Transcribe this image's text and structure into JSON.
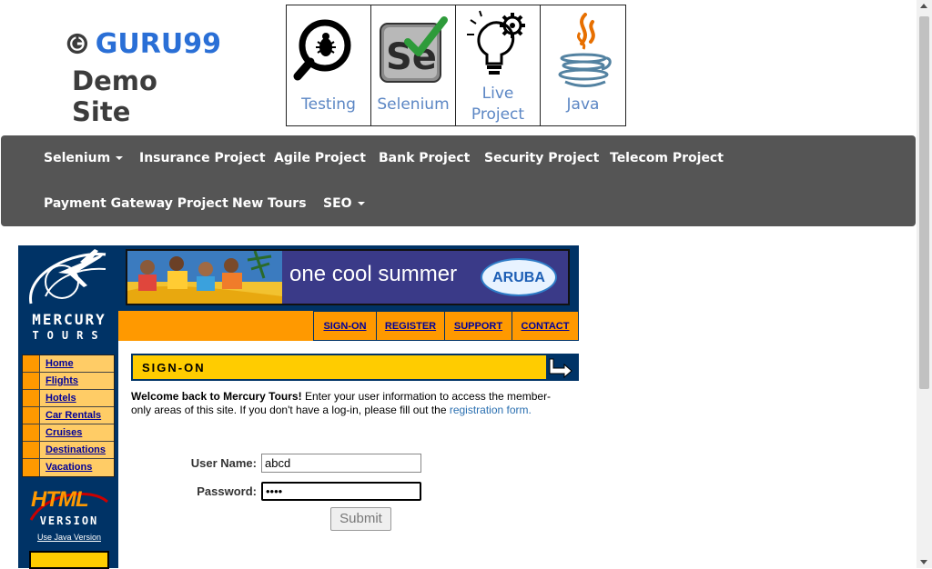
{
  "header": {
    "brand_name": "GURU99",
    "brand_subtitle": "Demo Site",
    "tiles": [
      {
        "label": "Testing",
        "icon": "bug-magnifier-icon"
      },
      {
        "label": "Selenium",
        "icon": "selenium-icon"
      },
      {
        "label": "Live\nProject",
        "label_lines": [
          "Live",
          "Project"
        ],
        "icon": "lightbulb-gear-icon"
      },
      {
        "label": "Java",
        "icon": "java-cup-icon"
      }
    ]
  },
  "nav": {
    "items": [
      {
        "label": "Selenium",
        "dropdown": true
      },
      {
        "label": "Insurance Project"
      },
      {
        "label": "Agile Project"
      },
      {
        "label": "Bank Project"
      },
      {
        "label": "Security Project"
      },
      {
        "label": "Telecom Project"
      },
      {
        "label": "Payment Gateway Project"
      },
      {
        "label": "New Tours"
      },
      {
        "label": "SEO",
        "dropdown": true
      }
    ]
  },
  "mercury": {
    "logo_title": "MERCURY",
    "logo_subtitle": "TOURS",
    "side_menu": [
      "Home",
      "Flights",
      "Hotels",
      "Car Rentals",
      "Cruises",
      "Destinations",
      "Vacations"
    ],
    "html_version": {
      "word1": "HTML",
      "word2": "VERSION",
      "java_link": "Use Java Version"
    },
    "banner": {
      "text": "one cool summer",
      "badge": "ARUBA"
    },
    "top_links": [
      "SIGN-ON",
      "REGISTER",
      "SUPPORT",
      "CONTACT"
    ],
    "signon_title": "SIGN-ON",
    "welcome_bold": "Welcome back to Mercury Tours!",
    "welcome_text": " Enter your user information to access the member-only areas of this site. If you don't have a log-in, please fill out the ",
    "registration_link": "registration form.",
    "form": {
      "username_label": "User Name:",
      "username_value": "abcd",
      "password_label": "Password:",
      "password_value": "••••",
      "submit_label": "Submit"
    }
  },
  "colors": {
    "brand_blue": "#2a6fd6",
    "nav_bg": "#555555",
    "mercury_navy": "#003366",
    "mercury_orange": "#ff9900",
    "signon_yellow": "#ffcc00",
    "link_blue": "#000099"
  }
}
